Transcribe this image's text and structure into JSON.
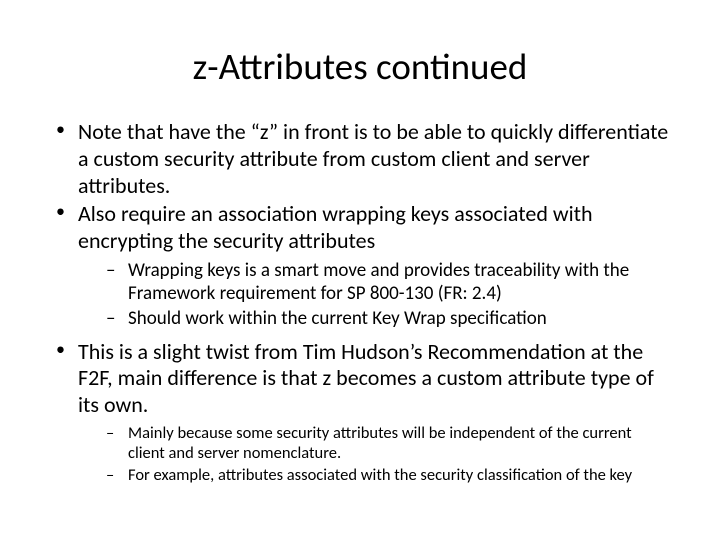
{
  "title": "z-Attributes continued",
  "bullets": {
    "b1": "Note that have the “z” in front is to be able to quickly differentiate a custom security attribute from custom client and server attributes.",
    "b2": " Also require an association wrapping keys associated with encrypting the security attributes",
    "b2_sub1": "Wrapping keys is a smart move and provides traceability with the Framework requirement for SP 800-130 (FR: 2.4)",
    "b2_sub2": "Should work within the current Key Wrap specification",
    "b3": "This is a slight twist from Tim Hudson’s Recommendation at the F2F, main difference is that z becomes a custom attribute type of its own.",
    "b3_sub1": "Mainly because some security attributes will be independent of the current client and server nomenclature.",
    "b3_sub2": "For example, attributes associated with the security classification of the key"
  }
}
